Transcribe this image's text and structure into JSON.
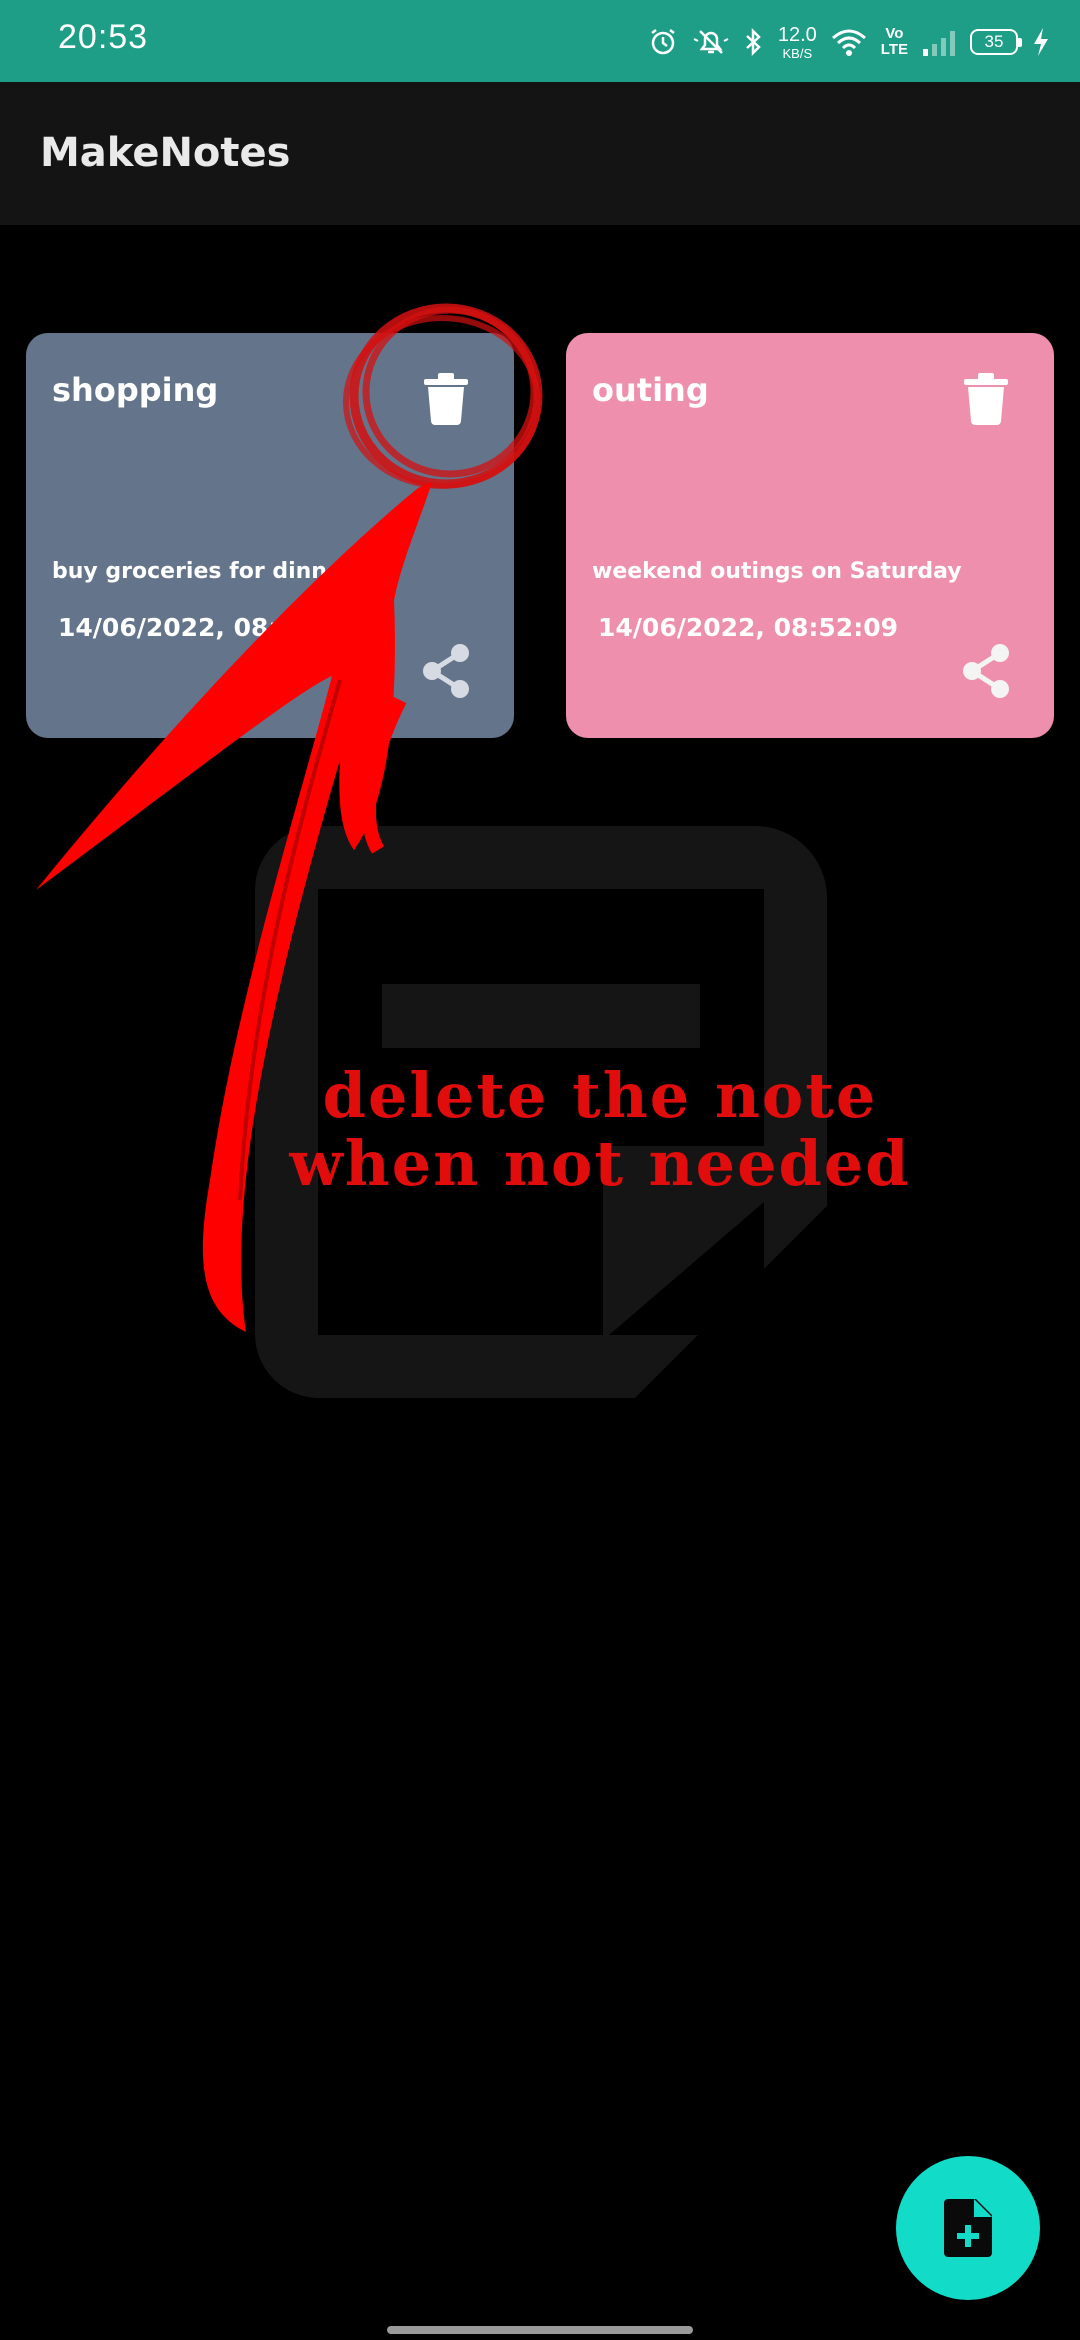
{
  "status_bar": {
    "time": "20:53",
    "net_speed_value": "12.0",
    "net_speed_unit": "KB/S",
    "volte_top": "Vo",
    "volte_bottom": "LTE",
    "battery_level": "35"
  },
  "app": {
    "title": "MakeNotes"
  },
  "notes": [
    {
      "title": "shopping",
      "body": "buy groceries for dinner",
      "date": "14/06/2022, 08:51:5",
      "color": "#64748b"
    },
    {
      "title": "outing",
      "body": "weekend outings on Saturday",
      "date": "14/06/2022, 08:52:09",
      "color": "#ee8fad"
    }
  ],
  "annotation": {
    "line1": "delete the note",
    "line2": "when not needed",
    "color": "#e10c0c"
  },
  "fab": {
    "icon": "note-add-icon",
    "color": "#12dbc8"
  },
  "icons": {
    "delete": "trash-icon",
    "share": "share-icon"
  }
}
